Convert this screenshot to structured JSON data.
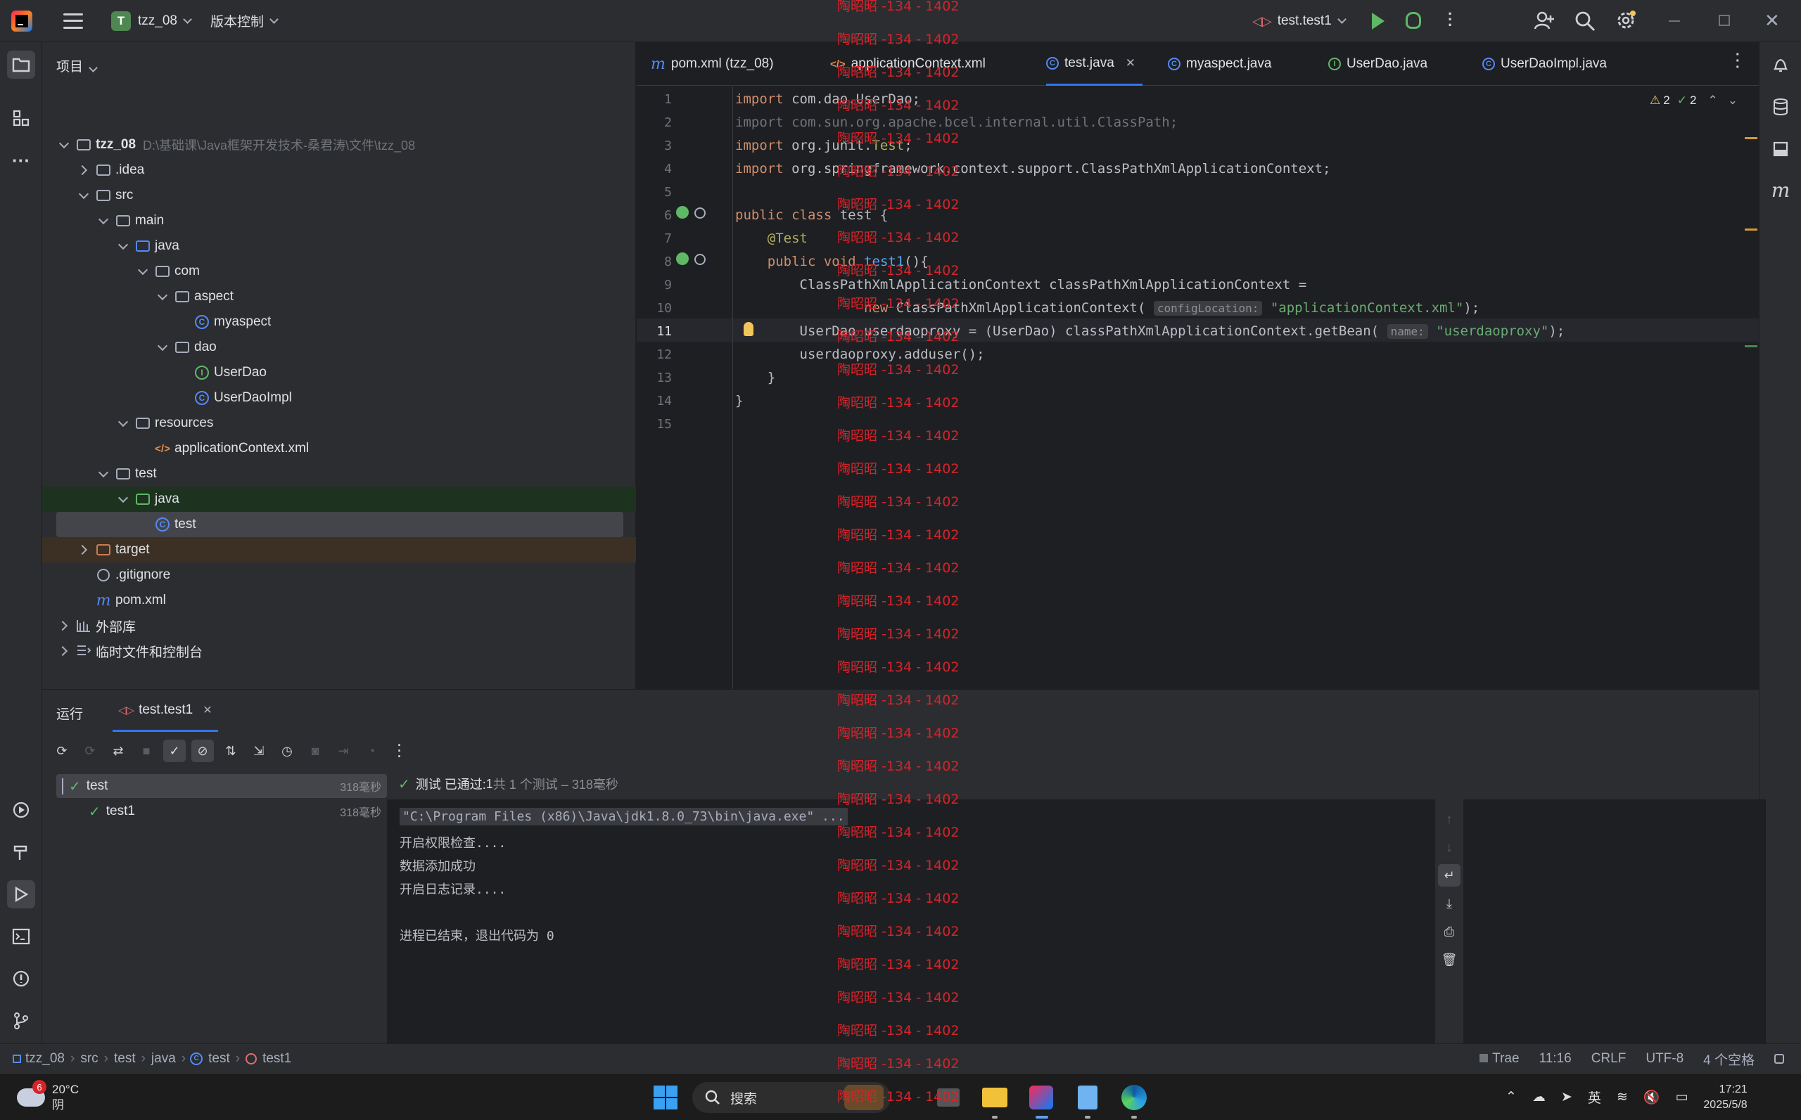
{
  "titlebar": {
    "project_badge": "T",
    "project_name": "tzz_08",
    "vcs_label": "版本控制",
    "run_config": "test.test1"
  },
  "project_panel": {
    "title": "项目",
    "tree": [
      {
        "label": "tzz_08",
        "path": "D:\\基础课\\Java框架开发技术-桑君涛\\文件\\tzz_08"
      },
      {
        "label": ".idea"
      },
      {
        "label": "src"
      },
      {
        "label": "main"
      },
      {
        "label": "java"
      },
      {
        "label": "com"
      },
      {
        "label": "aspect"
      },
      {
        "label": "myaspect"
      },
      {
        "label": "dao"
      },
      {
        "label": "UserDao"
      },
      {
        "label": "UserDaoImpl"
      },
      {
        "label": "resources"
      },
      {
        "label": "applicationContext.xml"
      },
      {
        "label": "test"
      },
      {
        "label": "java"
      },
      {
        "label": "test"
      },
      {
        "label": "target"
      },
      {
        "label": ".gitignore"
      },
      {
        "label": "pom.xml"
      },
      {
        "label": "外部库"
      },
      {
        "label": "临时文件和控制台"
      }
    ]
  },
  "editor": {
    "tabs": [
      {
        "label": "pom.xml (tzz_08)"
      },
      {
        "label": "applicationContext.xml"
      },
      {
        "label": "test.java"
      },
      {
        "label": "myaspect.java"
      },
      {
        "label": "UserDao.java"
      },
      {
        "label": "UserDaoImpl.java"
      }
    ],
    "inspections": {
      "warnings": "2",
      "ok": "2"
    },
    "line_numbers": [
      "1",
      "2",
      "3",
      "4",
      "5",
      "6",
      "7",
      "8",
      "9",
      "10",
      "11",
      "12",
      "13",
      "14",
      "15"
    ],
    "hints": {
      "config_location": "configLocation:",
      "name": "name:"
    }
  },
  "run_panel": {
    "header": "运行",
    "tab": "test.test1",
    "summary_passed": "测试 已通过: ",
    "summary_count": "1",
    "summary_rest": "共 1 个测试 – 318毫秒",
    "tests": [
      {
        "name": "test",
        "duration": "318毫秒"
      },
      {
        "name": "test1",
        "duration": "318毫秒"
      }
    ],
    "console": [
      "\"C:\\Program Files (x86)\\Java\\jdk1.8.0_73\\bin\\java.exe\" ...",
      "开启权限检查....",
      "数据添加成功",
      "开启日志记录....",
      "",
      "进程已结束，退出代码为 0"
    ]
  },
  "statusbar": {
    "breadcrumbs": [
      "tzz_08",
      "src",
      "test",
      "java",
      "test",
      "test1"
    ],
    "trae": "Trae",
    "position": "11:16",
    "line_sep": "CRLF",
    "encoding": "UTF-8",
    "indent": "4 个空格"
  },
  "taskbar": {
    "weather_badge": "6",
    "temperature": "20°C",
    "condition": "阴",
    "search_placeholder": "搜索",
    "ime": "英",
    "time": "17:21",
    "date": "2025/5/8"
  },
  "watermark": {
    "text": "陶昭昭 -134 - 1402",
    "color": "#d6242b"
  }
}
